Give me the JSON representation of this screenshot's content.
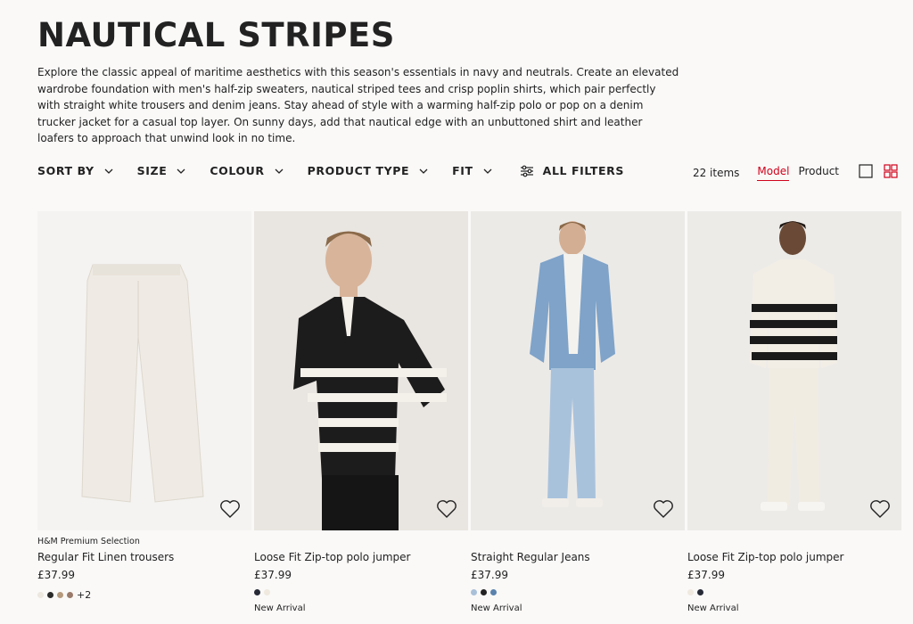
{
  "page": {
    "title": "NAUTICAL STRIPES",
    "description": "Explore the classic appeal of maritime aesthetics with this season's essentials in navy and neutrals. Create an elevated wardrobe foundation with men's half-zip sweaters, nautical striped tees and crisp poplin shirts, which pair perfectly with straight white trousers and denim jeans. Stay ahead of style with a warming half-zip polo or pop on a denim trucker jacket for a casual top layer. On sunny days, add that nautical edge with an unbuttoned shirt and leather loafers to approach that unwind look in no time."
  },
  "filters": {
    "sort_by": "SORT BY",
    "size": "SIZE",
    "colour": "COLOUR",
    "product_type": "PRODUCT TYPE",
    "fit": "FIT",
    "all_filters": "ALL FILTERS"
  },
  "tools": {
    "item_count": "22 items",
    "model": "Model",
    "product": "Product",
    "active_view": "Model",
    "accent": "#d0021b"
  },
  "products": [
    {
      "brand": "H&M Premium Selection",
      "name": "Regular Fit Linen trousers",
      "price": "£37.99",
      "swatches": [
        "#ece7df",
        "#2a2a2a",
        "#b69a7d",
        "#9a7b6b"
      ],
      "more": "+2",
      "badge": ""
    },
    {
      "brand": "",
      "name": "Loose Fit Zip-top polo jumper",
      "price": "£37.99",
      "swatches": [
        "#262a36",
        "#efe9df"
      ],
      "more": "",
      "badge": "New Arrival"
    },
    {
      "brand": "",
      "name": "Straight Regular Jeans",
      "price": "£37.99",
      "swatches": [
        "#a9c0d8",
        "#222222",
        "#5a82ad"
      ],
      "more": "",
      "badge": "New Arrival"
    },
    {
      "brand": "",
      "name": "Loose Fit Zip-top polo jumper",
      "price": "£37.99",
      "swatches": [
        "#efe9df",
        "#262a36"
      ],
      "more": "",
      "badge": "New Arrival"
    }
  ]
}
